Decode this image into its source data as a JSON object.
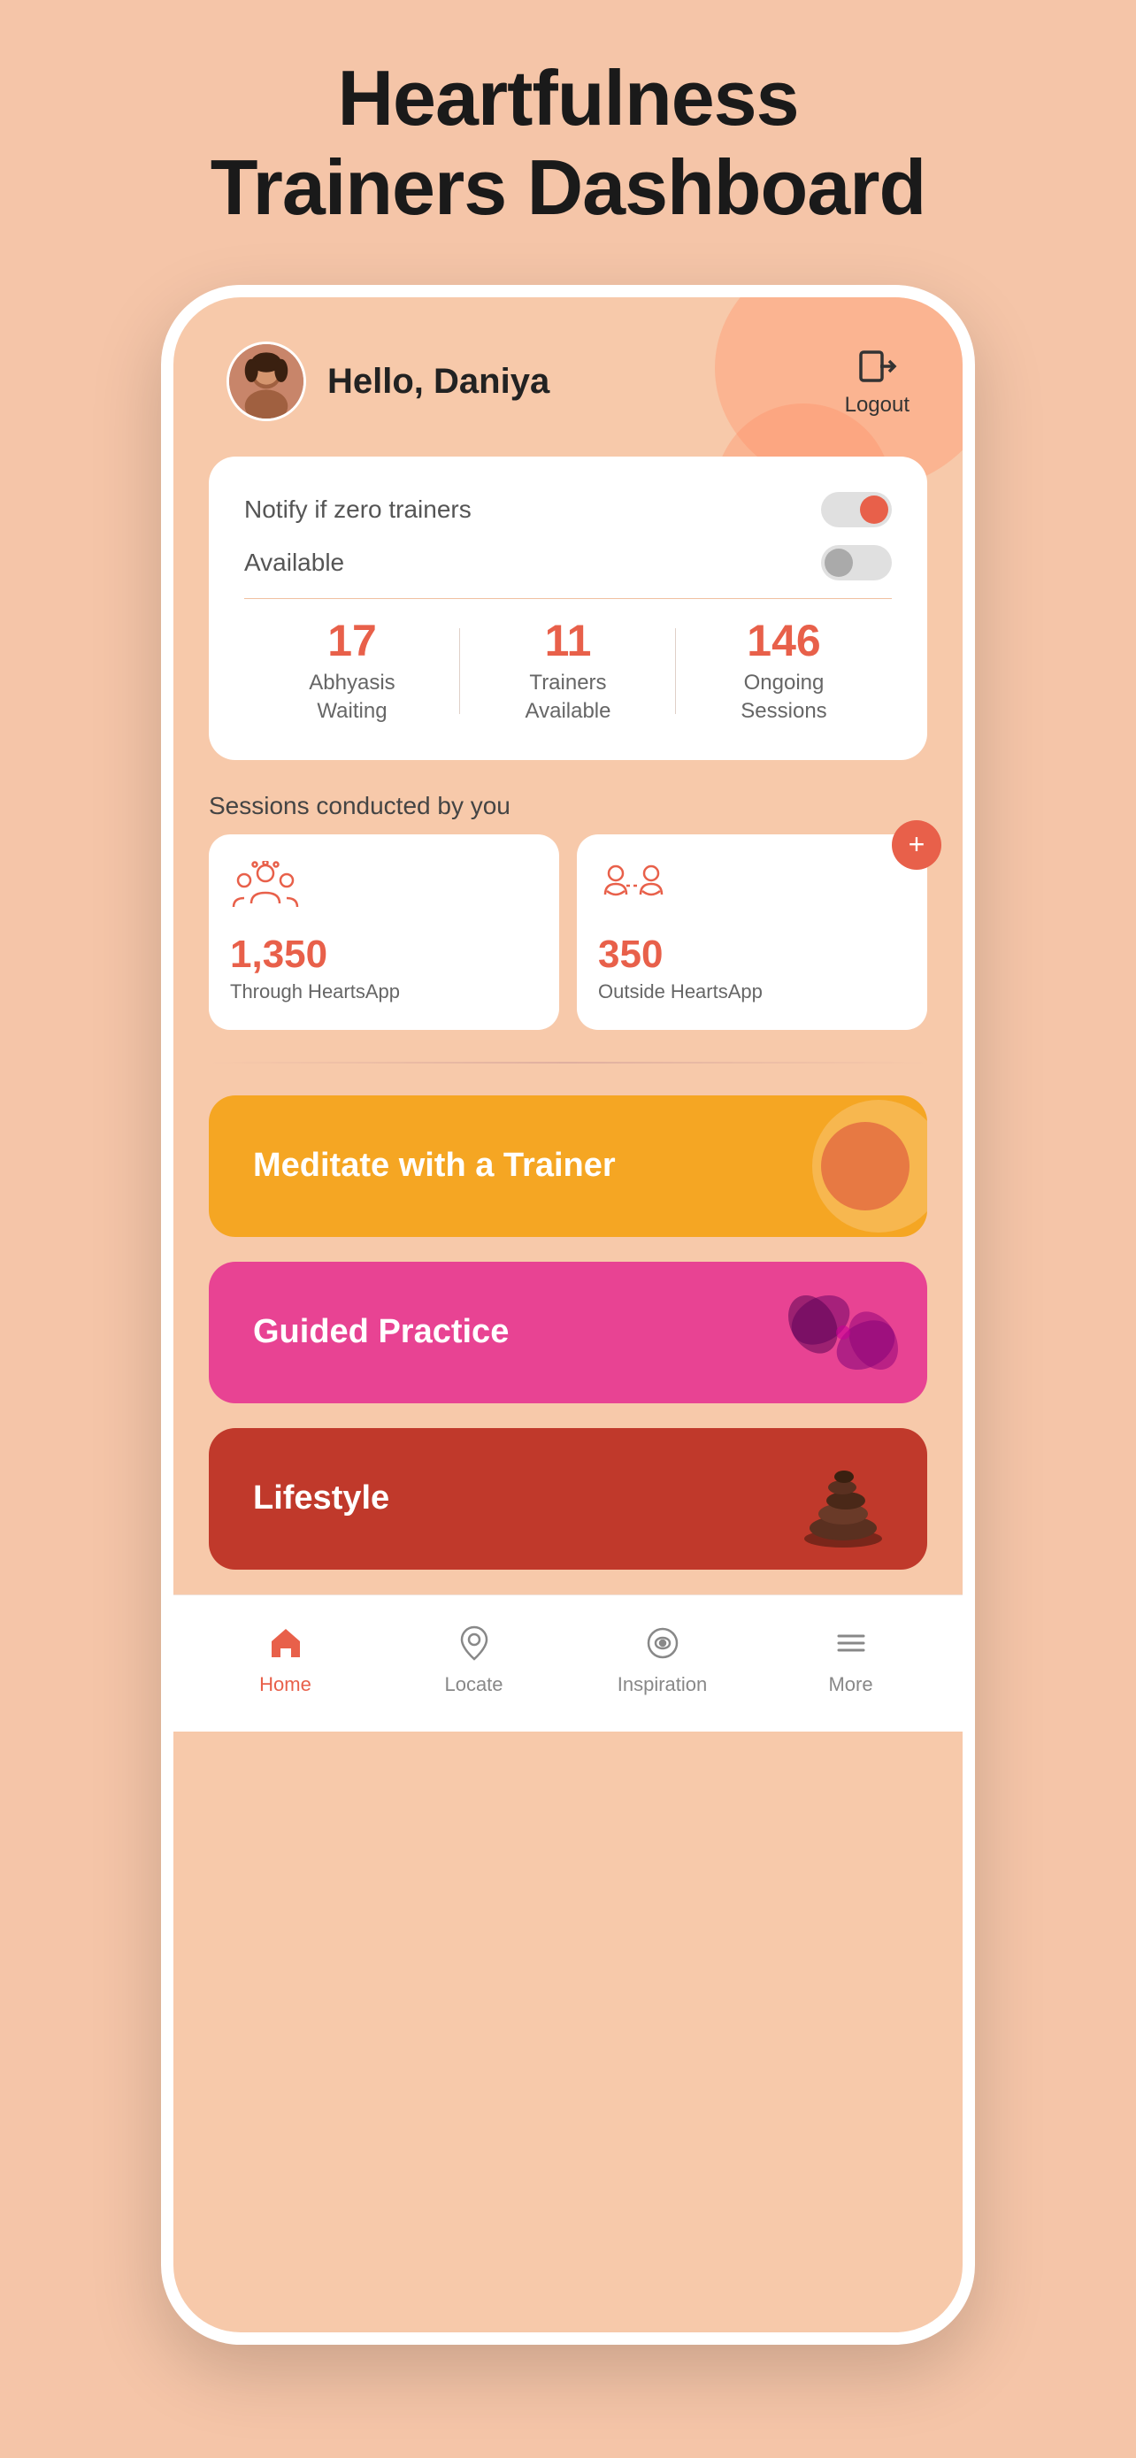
{
  "page": {
    "title_line1": "Heartfulness",
    "title_line2": "Trainers Dashboard"
  },
  "header": {
    "greeting": "Hello, Daniya",
    "logout_label": "Logout"
  },
  "stats_card": {
    "notify_label": "Notify if zero trainers",
    "available_label": "Available",
    "notify_toggle": true,
    "available_toggle": false,
    "stats": [
      {
        "number": "17",
        "label_line1": "Abhyasis",
        "label_line2": "Waiting"
      },
      {
        "number": "11",
        "label_line1": "Trainers",
        "label_line2": "Available"
      },
      {
        "number": "146",
        "label_line1": "Ongoing",
        "label_line2": "Sessions"
      }
    ]
  },
  "sessions": {
    "section_label": "Sessions conducted by you",
    "cards": [
      {
        "number": "1,350",
        "label": "Through HeartsApp"
      },
      {
        "number": "350",
        "label": "Outside HeartsApp"
      }
    ],
    "add_button_label": "+"
  },
  "feature_cards": [
    {
      "id": "meditate",
      "label": "Meditate with a Trainer"
    },
    {
      "id": "guided",
      "label": "Guided Practice"
    },
    {
      "id": "lifestyle",
      "label": "Lifestyle"
    }
  ],
  "bottom_nav": {
    "items": [
      {
        "id": "home",
        "label": "Home",
        "active": true
      },
      {
        "id": "locate",
        "label": "Locate",
        "active": false
      },
      {
        "id": "inspiration",
        "label": "Inspiration",
        "active": false
      },
      {
        "id": "more",
        "label": "More",
        "active": false
      }
    ]
  },
  "colors": {
    "accent": "#e8604a",
    "background": "#f5c5a8",
    "card_bg": "#ffffff"
  }
}
